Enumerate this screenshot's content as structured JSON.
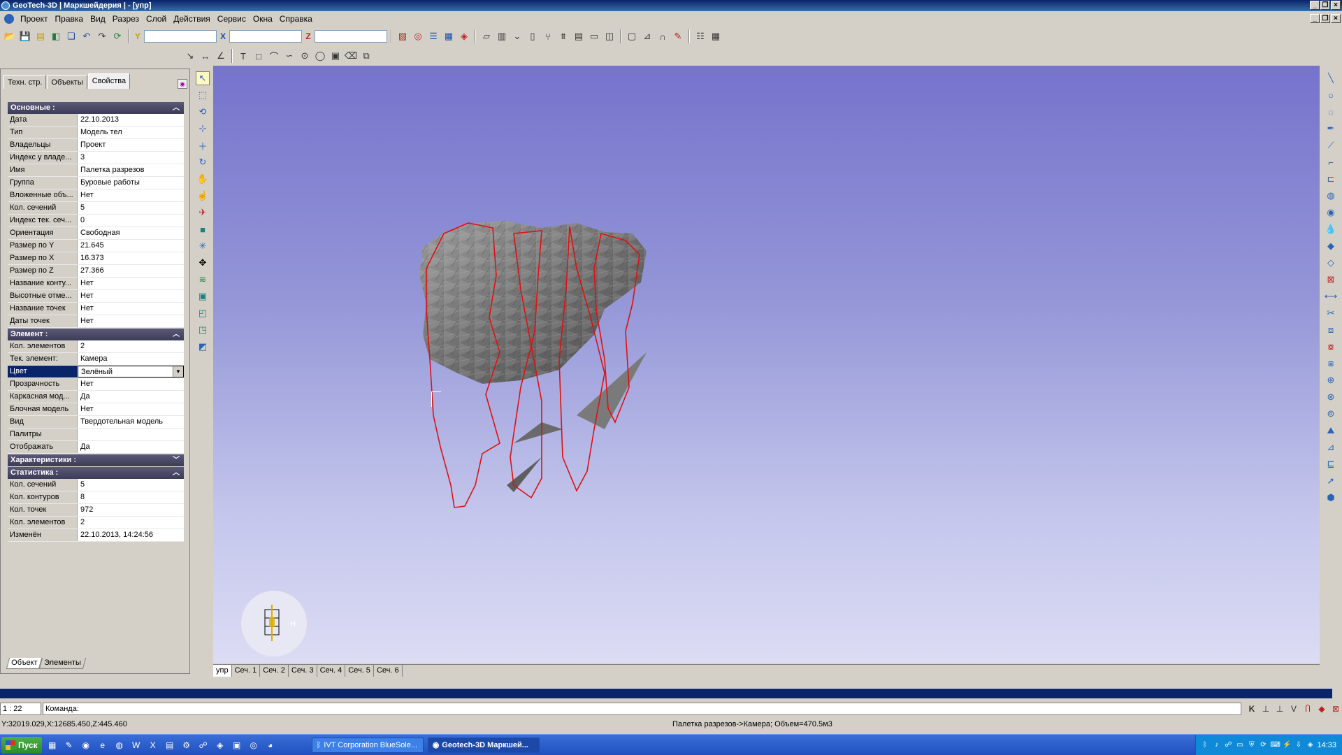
{
  "window": {
    "title": "GeoTech-3D | Маркшейдерия | - [упр]"
  },
  "menu": [
    "Проект",
    "Правка",
    "Вид",
    "Разрез",
    "Слой",
    "Действия",
    "Сервис",
    "Окна",
    "Справка"
  ],
  "coords": {
    "y_label": "Y",
    "x_label": "X",
    "z_label": "Z",
    "y_value": "",
    "x_value": "",
    "z_value": ""
  },
  "panel": {
    "tabs": [
      "Техн. стр.",
      "Объекты",
      "Свойства"
    ],
    "active_tab": "Свойства",
    "sections": [
      {
        "title": "Основные :",
        "chevron": "up",
        "rows": [
          {
            "k": "Дата",
            "v": "22.10.2013"
          },
          {
            "k": "Тип",
            "v": "Модель тел"
          },
          {
            "k": "Владельцы",
            "v": "Проект"
          },
          {
            "k": "Индекс у владе...",
            "v": "3"
          },
          {
            "k": "Имя",
            "v": "Палетка разрезов"
          },
          {
            "k": "Группа",
            "v": "Буровые работы"
          },
          {
            "k": "Вложенные объ...",
            "v": "Нет"
          },
          {
            "k": "Кол. сечений",
            "v": "5"
          },
          {
            "k": "Индекс тек. сеч...",
            "v": "0"
          },
          {
            "k": "Ориентация",
            "v": "Свободная"
          },
          {
            "k": "Размер по Y",
            "v": "21.645"
          },
          {
            "k": "Размер по X",
            "v": "16.373"
          },
          {
            "k": "Размер по Z",
            "v": "27.366"
          },
          {
            "k": "Название конту...",
            "v": "Нет"
          },
          {
            "k": "Высотные отме...",
            "v": "Нет"
          },
          {
            "k": "Название точек",
            "v": "Нет"
          },
          {
            "k": "Даты точек",
            "v": "Нет"
          }
        ]
      },
      {
        "title": "Элемент :",
        "chevron": "up",
        "rows": [
          {
            "k": "Кол. элементов",
            "v": "2"
          },
          {
            "k": "Тек. элемент:",
            "v": "Камера"
          },
          {
            "k": "Цвет",
            "v": "Зелёный",
            "selected": true
          },
          {
            "k": "Прозрачность",
            "v": "Нет"
          },
          {
            "k": "Каркасная мод...",
            "v": "Да"
          },
          {
            "k": "Блочная модель",
            "v": "Нет"
          },
          {
            "k": "Вид",
            "v": "Твердотельная модель"
          },
          {
            "k": "Палитры",
            "v": ""
          },
          {
            "k": "Отображать",
            "v": "Да"
          }
        ]
      },
      {
        "title": "Характеристики :",
        "chevron": "down",
        "rows": []
      },
      {
        "title": "Статистика :",
        "chevron": "up",
        "rows": [
          {
            "k": "Кол. сечений",
            "v": "5"
          },
          {
            "k": "Кол. контуров",
            "v": "8"
          },
          {
            "k": "Кол. точек",
            "v": "972"
          },
          {
            "k": "Кол. элементов",
            "v": "2"
          },
          {
            "k": "Изменён",
            "v": "22.10.2013, 14:24:56"
          }
        ]
      }
    ],
    "bottom_tabs": [
      "Объект",
      "Элементы"
    ]
  },
  "section_tabs": [
    "упр",
    "Сеч. 1",
    "Сеч. 2",
    "Сеч. 3",
    "Сеч. 4",
    "Сеч. 5",
    "Сеч. 6"
  ],
  "orient_label": "Н",
  "scale": "1 : 22",
  "command_prompt": "Команда:",
  "status": {
    "coords": "Y:32019.029,X:12685.450,Z:445.460",
    "info": "Палетка разрезов->Камера; Объем=470.5м3"
  },
  "taskbar": {
    "start": "Пуск",
    "tasks": [
      {
        "label": "IVT Corporation BlueSole...",
        "active": false
      },
      {
        "label": "Geotech-3D Маркшей...",
        "active": true
      }
    ],
    "clock": "14:33"
  },
  "colors": {
    "viewport_top": "#7573cc",
    "viewport_bottom": "#dcdcf4",
    "contour": "#e01010",
    "model": "#7a7a7a"
  }
}
